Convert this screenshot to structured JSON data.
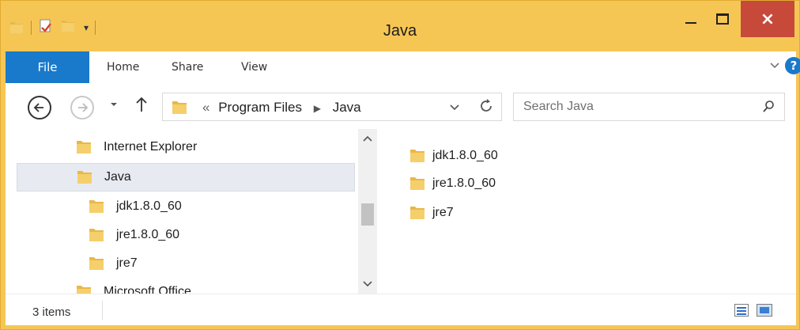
{
  "window": {
    "title": "Java",
    "close_glyph": "×"
  },
  "quick_access": {
    "dropdown_glyph": "▾",
    "icons": [
      "folder-icon",
      "properties-icon",
      "new-folder-icon"
    ]
  },
  "ribbon": {
    "tabs": [
      {
        "label": "File"
      },
      {
        "label": "Home"
      },
      {
        "label": "Share"
      },
      {
        "label": "View"
      }
    ],
    "help_glyph": "?"
  },
  "address_bar": {
    "breadcrumbs": [
      {
        "label": "Program Files"
      },
      {
        "label": "Java"
      }
    ],
    "overflow_glyph": "«",
    "separator_glyph": "▶"
  },
  "search": {
    "placeholder": "Search Java"
  },
  "nav_tree": {
    "items": [
      {
        "label": "Internet Explorer",
        "selected": false
      },
      {
        "label": "Java",
        "selected": true
      },
      {
        "label": "jdk1.8.0_60",
        "selected": false
      },
      {
        "label": "jre1.8.0_60",
        "selected": false
      },
      {
        "label": "jre7",
        "selected": false
      },
      {
        "label": "Microsoft Office",
        "selected": false
      }
    ]
  },
  "files": [
    {
      "label": "jdk1.8.0_60"
    },
    {
      "label": "jre1.8.0_60"
    },
    {
      "label": "jre7"
    }
  ],
  "status": {
    "item_count": "3 items"
  },
  "colors": {
    "frame": "#f6c655",
    "file_tab": "#1979ca",
    "close_button": "#c7493a",
    "folder": "#e8b84a"
  }
}
